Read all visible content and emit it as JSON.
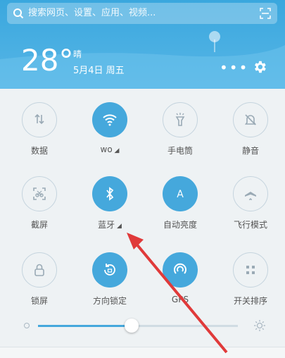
{
  "search": {
    "placeholder": "搜索网页、设置、应用、视频..."
  },
  "weather": {
    "temperature": "28°",
    "condition": "晴",
    "date": "5月4日 周五"
  },
  "toggles": [
    {
      "label": "数据",
      "icon": "data-arrows-icon",
      "on": false
    },
    {
      "label": "wo",
      "icon": "wifi-icon",
      "on": true
    },
    {
      "label": "手电筒",
      "icon": "flashlight-icon",
      "on": false
    },
    {
      "label": "静音",
      "icon": "bell-mute-icon",
      "on": false
    },
    {
      "label": "截屏",
      "icon": "screenshot-icon",
      "on": false
    },
    {
      "label": "蓝牙",
      "icon": "bluetooth-icon",
      "on": true
    },
    {
      "label": "自动亮度",
      "icon": "auto-brightness-icon",
      "on": true
    },
    {
      "label": "飞行模式",
      "icon": "airplane-icon",
      "on": false
    },
    {
      "label": "锁屏",
      "icon": "lock-icon",
      "on": false
    },
    {
      "label": "方向锁定",
      "icon": "rotation-lock-icon",
      "on": true
    },
    {
      "label": "GPS",
      "icon": "gps-icon",
      "on": true
    },
    {
      "label": "开关排序",
      "icon": "sort-grid-icon",
      "on": false
    }
  ],
  "brightness": {
    "level": 0.47
  },
  "colors": {
    "accent": "#45a8dc",
    "annotation_arrow": "#e03a3a"
  }
}
